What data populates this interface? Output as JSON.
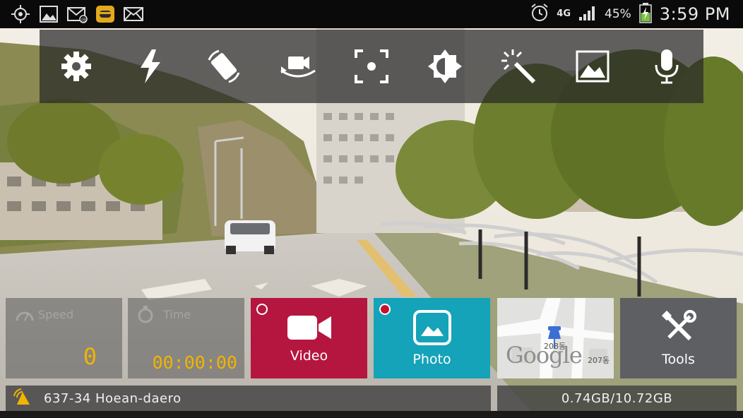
{
  "status_bar": {
    "left_icons": [
      "gps-icon",
      "gallery-icon",
      "email-icon",
      "app-icon",
      "mail-icon"
    ],
    "network": "4G",
    "battery": "45%",
    "time": "3:59 PM"
  },
  "toolbar": {
    "buttons": [
      {
        "name": "settings-button",
        "icon": "gear-icon"
      },
      {
        "name": "flash-button",
        "icon": "flash-icon"
      },
      {
        "name": "rotate-button",
        "icon": "rotate-icon"
      },
      {
        "name": "switch-camera-button",
        "icon": "switch-camera-icon"
      },
      {
        "name": "focus-button",
        "icon": "focus-icon"
      },
      {
        "name": "brightness-button",
        "icon": "brightness-icon"
      },
      {
        "name": "effects-button",
        "icon": "magic-wand-icon"
      },
      {
        "name": "gallery-button",
        "icon": "image-icon"
      },
      {
        "name": "microphone-button",
        "icon": "microphone-icon"
      }
    ]
  },
  "tiles": {
    "speed": {
      "label": "Speed",
      "value": "0"
    },
    "time": {
      "label": "Time",
      "value": "00:00:00"
    },
    "video": {
      "label": "Video",
      "color": "#b5163f"
    },
    "photo": {
      "label": "Photo",
      "color": "#14a3b8"
    },
    "map": {
      "brand": "Google",
      "label1": "208동",
      "label2": "207동"
    },
    "tools": {
      "label": "Tools",
      "color": "#5d5f63"
    }
  },
  "bottom": {
    "address": "637-34 Hoean-daero",
    "storage": "0.74GB/10.72GB"
  },
  "colors": {
    "accent": "#f1b400"
  }
}
